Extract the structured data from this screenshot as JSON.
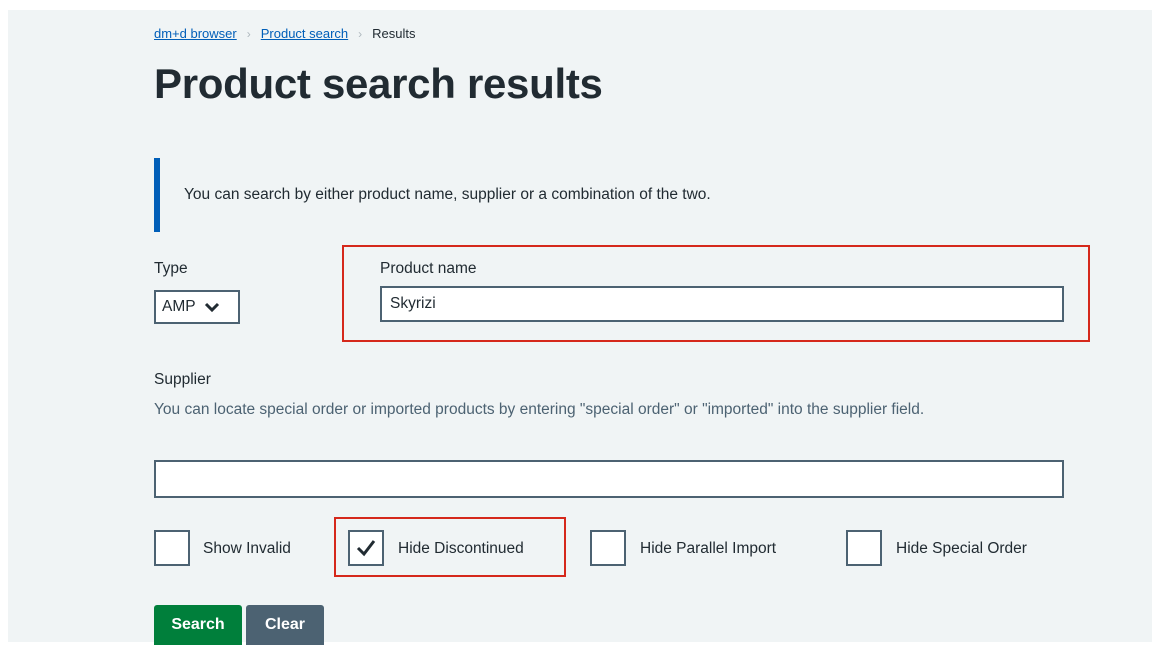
{
  "breadcrumb": {
    "items": [
      "dm+d browser",
      "Product search"
    ],
    "current": "Results"
  },
  "page_title": "Product search results",
  "inset_text": "You can search by either product name, supplier or a combination of the two.",
  "type": {
    "label": "Type",
    "selected": "AMP"
  },
  "product_name": {
    "label": "Product name",
    "value": "Skyrizi"
  },
  "supplier": {
    "label": "Supplier",
    "hint": "You can locate special order or imported products by entering \"special order\" or \"imported\" into the supplier field.",
    "value": ""
  },
  "checkboxes": [
    {
      "label": "Show Invalid",
      "checked": false
    },
    {
      "label": "Hide Discontinued",
      "checked": true
    },
    {
      "label": "Hide Parallel Import",
      "checked": false
    },
    {
      "label": "Hide Special Order",
      "checked": false
    }
  ],
  "buttons": {
    "search": "Search",
    "clear": "Clear"
  },
  "colors": {
    "link": "#005eb8",
    "highlight": "#d5281b",
    "search_button": "#007f3b",
    "clear_button": "#4c6272"
  }
}
